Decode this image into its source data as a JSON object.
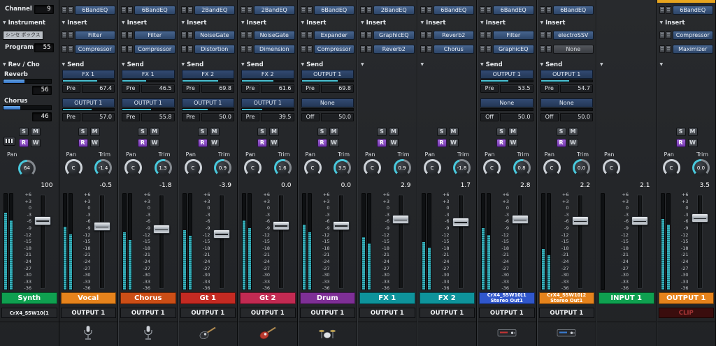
{
  "labels": {
    "insert": "Insert",
    "send": "Send",
    "pan": "Pan",
    "trim": "Trim",
    "solo": "S",
    "mute": "M",
    "read": "R",
    "write": "W"
  },
  "colors": {
    "master_top_bar": "#e8a51e",
    "meter_teal": "#38b2bd",
    "send_level_cyan": "#3fc3d6",
    "automation_read_purple": "#8a49c4"
  },
  "meter_scale": [
    "+6",
    "+3",
    "0",
    "-3",
    "-6",
    "-9",
    "-12",
    "-15",
    "-18",
    "-21",
    "-24",
    "-27",
    "-30",
    "-33",
    "-36"
  ],
  "left_panel": {
    "channel_label": "Channel",
    "channel_value": "9",
    "instrument_label": "Instrument",
    "instrument_name": "シンセ ボックス",
    "program_label": "Program",
    "program_value": "55",
    "revcho_label": "Rev / Cho",
    "reverb": {
      "label": "Reverb",
      "value": "56"
    },
    "chorus": {
      "label": "Chorus",
      "value": "46"
    },
    "pan_value": "64",
    "fader_value": "100",
    "meter_l": 80,
    "meter_r": 72,
    "name": "Synth",
    "name_color": "#0fa050",
    "output": "CrX4_SSW10(1"
  },
  "strips": [
    {
      "eq": "6BandEQ",
      "inserts": [
        "Filter",
        "Compressor"
      ],
      "send_header": "Send",
      "sends": [
        {
          "name": "FX 1",
          "mode": "Pre",
          "value": "67.4"
        },
        {
          "name": "OUTPUT 1",
          "mode": "Pre",
          "value": "57.0"
        }
      ],
      "buttons": true,
      "pan": "C",
      "trim": "-1.4",
      "fader": "-0.5",
      "meters": [
        66,
        58
      ],
      "name": "Vocal",
      "name_color": "#e6831c",
      "output": "OUTPUT 1",
      "icon": "mic"
    },
    {
      "eq": "6BandEQ",
      "inserts": [
        "Filter",
        "Compressor"
      ],
      "send_header": "Send",
      "sends": [
        {
          "name": "FX 1",
          "mode": "Pre",
          "value": "46.5"
        },
        {
          "name": "OUTPUT 1",
          "mode": "Pre",
          "value": "55.8"
        }
      ],
      "buttons": true,
      "pan": "C",
      "trim": "1.3",
      "fader": "-1.8",
      "meters": [
        60,
        52
      ],
      "name": "Chorus",
      "name_color": "#cc4e16",
      "output": "OUTPUT 1",
      "icon": "mic"
    },
    {
      "eq": "2BandEQ",
      "inserts": [
        "NoiseGate",
        "Distortion"
      ],
      "send_header": "Send",
      "sends": [
        {
          "name": "FX 2",
          "mode": "Pre",
          "value": "69.8"
        },
        {
          "name": "OUTPUT 1",
          "mode": "Pre",
          "value": "50.0"
        }
      ],
      "buttons": true,
      "pan": "C",
      "trim": "0.9",
      "fader": "-3.9",
      "meters": [
        62,
        56
      ],
      "name": "Gt 1",
      "name_color": "#c42a22",
      "output": "OUTPUT 1",
      "icon": "guitar-dark"
    },
    {
      "eq": "2BandEQ",
      "inserts": [
        "NoiseGate",
        "Dimension"
      ],
      "send_header": "Send",
      "sends": [
        {
          "name": "FX 2",
          "mode": "Pre",
          "value": "61.6"
        },
        {
          "name": "OUTPUT 1",
          "mode": "Pre",
          "value": "39.5"
        }
      ],
      "buttons": true,
      "pan": "C",
      "trim": "1.6",
      "fader": "0.0",
      "meters": [
        72,
        64
      ],
      "name": "Gt 2",
      "name_color": "#c22a52",
      "output": "OUTPUT 1",
      "icon": "guitar-red"
    },
    {
      "eq": "6BandEQ",
      "inserts": [
        "Expander",
        "Compressor"
      ],
      "send_header": "Send",
      "sends": [
        {
          "name": "OUTPUT 1",
          "mode": "Pre",
          "value": "69.8"
        },
        {
          "name": "None",
          "mode": "Off",
          "value": "50.0"
        }
      ],
      "buttons": true,
      "pan": "C",
      "trim": "3.5",
      "fader": "0.0",
      "meters": [
        68,
        60
      ],
      "name": "Drum",
      "name_color": "#7e2f96",
      "output": "OUTPUT 1",
      "icon": "drum"
    },
    {
      "eq": "2BandEQ",
      "inserts": [
        "GraphicEQ",
        "Reverb2"
      ],
      "send_header": "",
      "sends": [],
      "buttons": true,
      "pan": "C",
      "trim": "0.9",
      "fader": "2.9",
      "meters": [
        55,
        48
      ],
      "name": "FX 1",
      "name_color": "#0e939b",
      "output": "OUTPUT 1",
      "icon": null
    },
    {
      "eq": "6BandEQ",
      "inserts": [
        "Reverb2",
        "Chorus"
      ],
      "send_header": "",
      "sends": [],
      "buttons": true,
      "pan": "C",
      "trim": "-1.8",
      "fader": "1.7",
      "meters": [
        50,
        44
      ],
      "name": "FX 2",
      "name_color": "#0e939b",
      "output": "OUTPUT 1",
      "icon": null
    },
    {
      "eq": "6BandEQ",
      "inserts": [
        "Filter",
        "GraphicEQ"
      ],
      "send_header": "Send",
      "sends": [
        {
          "name": "OUTPUT 1",
          "mode": "Pre",
          "value": "53.5"
        },
        {
          "name": "None",
          "mode": "Off",
          "value": "50.0"
        }
      ],
      "buttons": true,
      "pan": "C",
      "trim": "0.8",
      "fader": "2.8",
      "meters": [
        64,
        57
      ],
      "name": "CrX4_SSW10[1",
      "name2": "Stereo Out1",
      "name_color": "#3057cc",
      "output": "OUTPUT 1",
      "icon": "device-red"
    },
    {
      "eq": "6BandEQ",
      "inserts": [
        "electroSSV",
        "None"
      ],
      "send_header": "Send",
      "sends": [
        {
          "name": "OUTPUT 1",
          "mode": "Pre",
          "value": "54.7"
        },
        {
          "name": "None",
          "mode": "Off",
          "value": "50.0"
        }
      ],
      "buttons": true,
      "pan": "C",
      "trim": "0.0",
      "fader": "2.2",
      "meters": [
        42,
        36
      ],
      "name": "CrX4_SSW10[2",
      "name2": "Stereo Out1",
      "name_color": "#e6831c",
      "output": "OUTPUT 1",
      "icon": "device-blue"
    },
    {
      "eq": null,
      "inserts": [],
      "send_header": "",
      "sends": [],
      "buttons": false,
      "pan": "C",
      "trim": null,
      "fader": "2.1",
      "meters": [
        0
      ],
      "name": "INPUT 1",
      "name_color": "#0fa050",
      "output": null,
      "icon": null
    },
    {
      "selected": true,
      "eq": "6BandEQ",
      "inserts": [
        "Compressor",
        "Maximizer"
      ],
      "send_header": "",
      "sends": [],
      "buttons": true,
      "pan": "C",
      "trim": "0.0",
      "fader": "3.5",
      "meters": [
        74,
        68
      ],
      "name": "OUTPUT 1",
      "name_color": "#e6831c",
      "output": null,
      "clip": "CLIP",
      "icon": null
    }
  ]
}
